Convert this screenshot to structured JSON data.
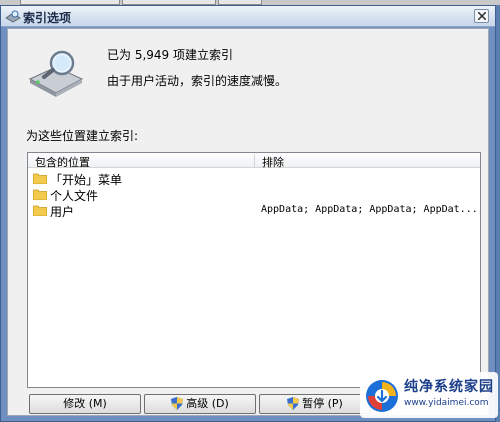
{
  "window": {
    "title": "索引选项"
  },
  "status": {
    "items_indexed": "已为 5,949 项建立索引",
    "message": "由于用户活动，索引的速度减慢。"
  },
  "section_label": "为这些位置建立索引:",
  "list": {
    "headers": [
      "包含的位置",
      "排除"
    ],
    "rows": [
      {
        "name": "「开始」菜单",
        "excludes": ""
      },
      {
        "name": "个人文件",
        "excludes": ""
      },
      {
        "name": "用户",
        "excludes": "AppData; AppData; AppData; AppDat..."
      }
    ]
  },
  "buttons": {
    "modify": "修改 (M)",
    "advanced": "高级 (D)",
    "pause": "暂停 (P)"
  },
  "watermark": {
    "title": "纯净系统家园",
    "url": "www.yidaimei.com"
  },
  "icons": {
    "title": "indexing-options-icon",
    "drive": "search-drive-icon",
    "folder": "folder-icon",
    "shield": "uac-shield-icon",
    "close": "close-icon"
  },
  "colors": {
    "folder": "#f2c94c",
    "titlebar": "#d6e2f0",
    "desktop": "#5a7fb0"
  }
}
